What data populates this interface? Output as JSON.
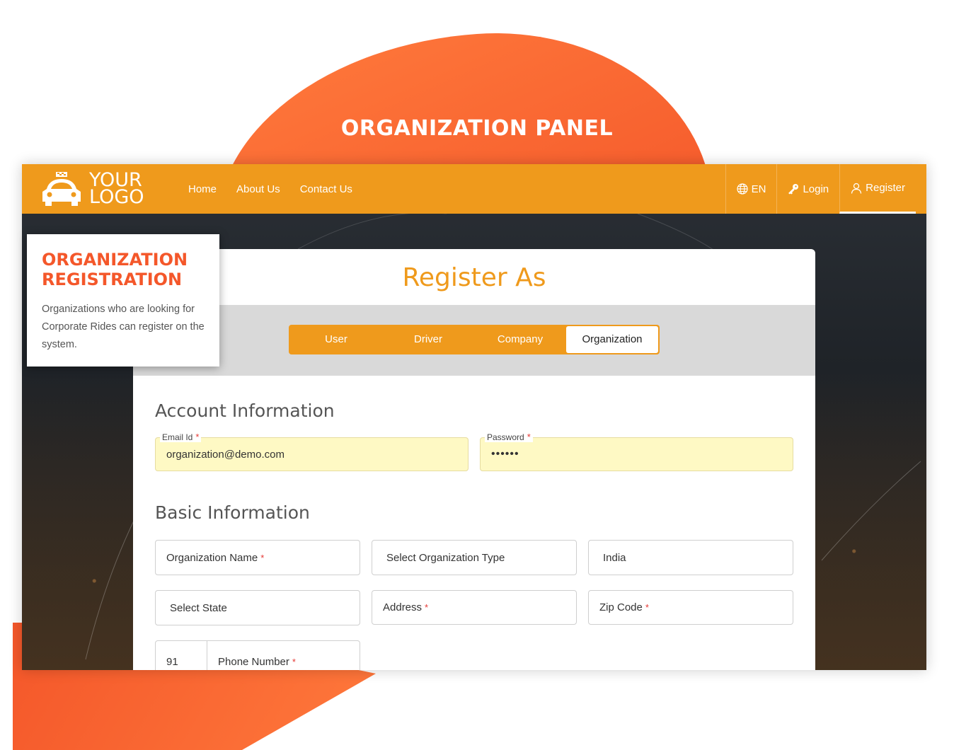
{
  "hero": {
    "title": "ORGANIZATION PANEL"
  },
  "navbar": {
    "logo_line1": "YOUR",
    "logo_line2": "LOGO",
    "links": [
      "Home",
      "About Us",
      "Contact Us"
    ],
    "language": "EN",
    "login": "Login",
    "register": "Register"
  },
  "info_box": {
    "title_line1": "ORGANIZATION",
    "title_line2": "REGISTRATION",
    "description": "Organizations who are looking for Corporate Rides can register on the system."
  },
  "card": {
    "title": "Register As",
    "tabs": [
      "User",
      "Driver",
      "Company",
      "Organization"
    ],
    "active_tab": "Organization"
  },
  "account": {
    "section_title": "Account Information",
    "email_label": "Email Id",
    "email_value": "organization@demo.com",
    "password_label": "Password",
    "password_value": "••••••"
  },
  "basic": {
    "section_title": "Basic Information",
    "org_name": "Organization Name",
    "org_type": "Select Organization Type",
    "country": "India",
    "state": "Select State",
    "address": "Address",
    "zip": "Zip Code",
    "phone_code": "91",
    "phone": "Phone Number"
  },
  "required_mark": "*",
  "colors": {
    "accent": "#ef9a1c",
    "brand_orange": "#f4572a",
    "autofill": "#fef9c4"
  }
}
